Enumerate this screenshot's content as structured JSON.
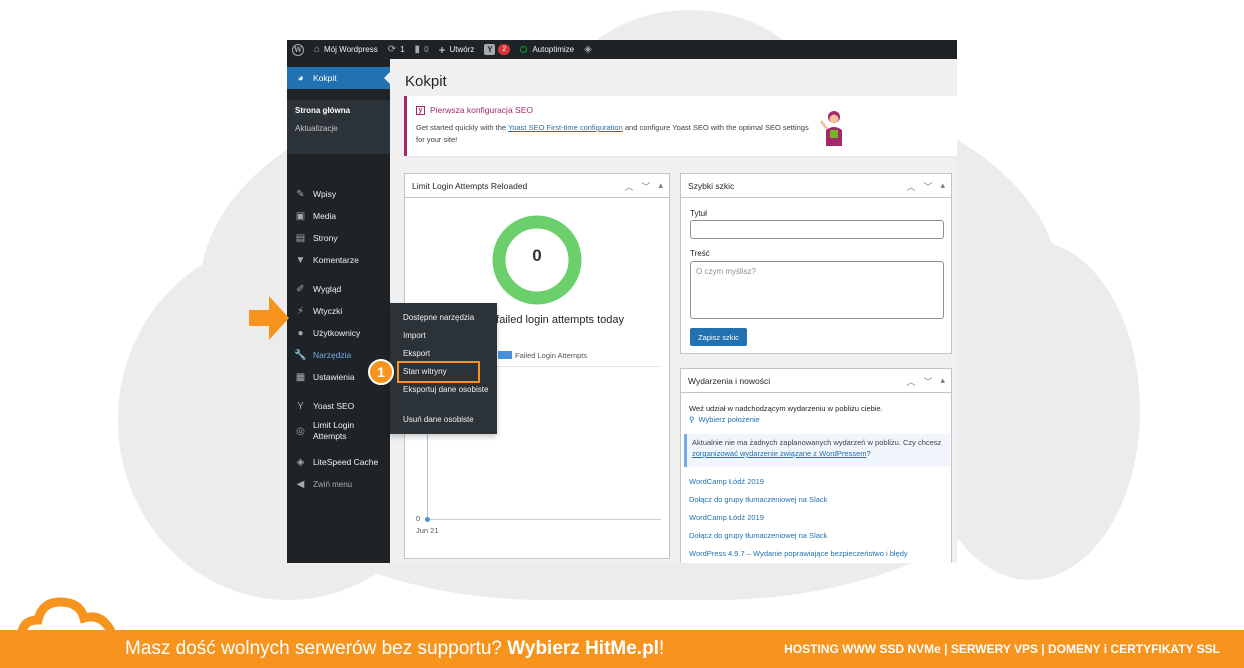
{
  "adminbar": {
    "site_name": "Mój Wordpress",
    "updates_count": "1",
    "comments_count": "0",
    "new_label": "Utwórz",
    "yoast_count": "2",
    "autoptimize_label": "Autoptimize"
  },
  "sidebar": {
    "dashboard_label": "Kokpit",
    "dashboard_sub": [
      "Strona główna",
      "Aktualizacje"
    ],
    "items": [
      "Wpisy",
      "Media",
      "Strony",
      "Komentarze",
      "Wygląd",
      "Wtyczki",
      "Użytkownicy",
      "Narzędzia",
      "Ustawienia",
      "Yoast SEO",
      "Limit Login Attempts",
      "LiteSpeed Cache",
      "Zwiń menu"
    ]
  },
  "flyout": {
    "items": [
      "Dostępne narzędzia",
      "Import",
      "Eksport",
      "Stan witryny",
      "Eksportuj dane osobiste",
      "Usuń dane osobiste"
    ]
  },
  "main": {
    "title": "Kokpit",
    "notice_title": "Pierwsza konfiguracja SEO",
    "notice_text_1": "Get started quickly with the ",
    "notice_link": "Yoast SEO First-time configuration",
    "notice_text_2": " and configure Yoast SEO with the optimal SEO settings for your site!"
  },
  "lla_box": {
    "title": "Limit Login Attempts Reloaded",
    "count": "0",
    "text": "o failed login attempts today",
    "legend": "Failed Login Attempts",
    "y_zero": "0",
    "x_date": "Jun 21"
  },
  "quick_draft": {
    "title": "Szybki szkic",
    "title_label": "Tytuł",
    "content_label": "Treść",
    "content_placeholder": "O czym myślisz?",
    "save_label": "Zapisz szkic"
  },
  "events": {
    "title": "Wydarzenia i nowości",
    "intro": "Weź udział w nadchodzącym wydarzeniu w pobliżu ciebie.",
    "location_label": "Wybierz położenie",
    "notice_1": "Aktualnie nie ma żadnych zaplanowanych wydarzeń w pobliżu. Czy chcesz ",
    "notice_link": "zorganizować wydarzenie związane z WordPressem",
    "notice_2": "?",
    "links": [
      "WordCamp Łódź 2019",
      "Dołącz do grupy tłumaczeniowej na Slack",
      "WordCamp Łódź 2019",
      "Dołącz do grupy tłumaczeniowej na Slack",
      "WordPress 4.9.7 – Wydanie poprawiające bezpieczeństwo i błędy"
    ]
  },
  "annotation": {
    "step": "1"
  },
  "footer": {
    "slogan_1": "Masz dość wolnych serwerów bez supportu? ",
    "slogan_bold": "Wybierz HitMe.pl",
    "slogan_2": "!",
    "right": "HOSTING WWW SSD NVMe | SERWERY VPS | DOMENY i CERTYFIKATY SSL"
  },
  "colors": {
    "accent": "#f7941d",
    "wp_dark": "#1d2327",
    "wp_blue": "#2271b1",
    "yoast": "#a4286a",
    "chart_green": "#6bcf6b"
  }
}
